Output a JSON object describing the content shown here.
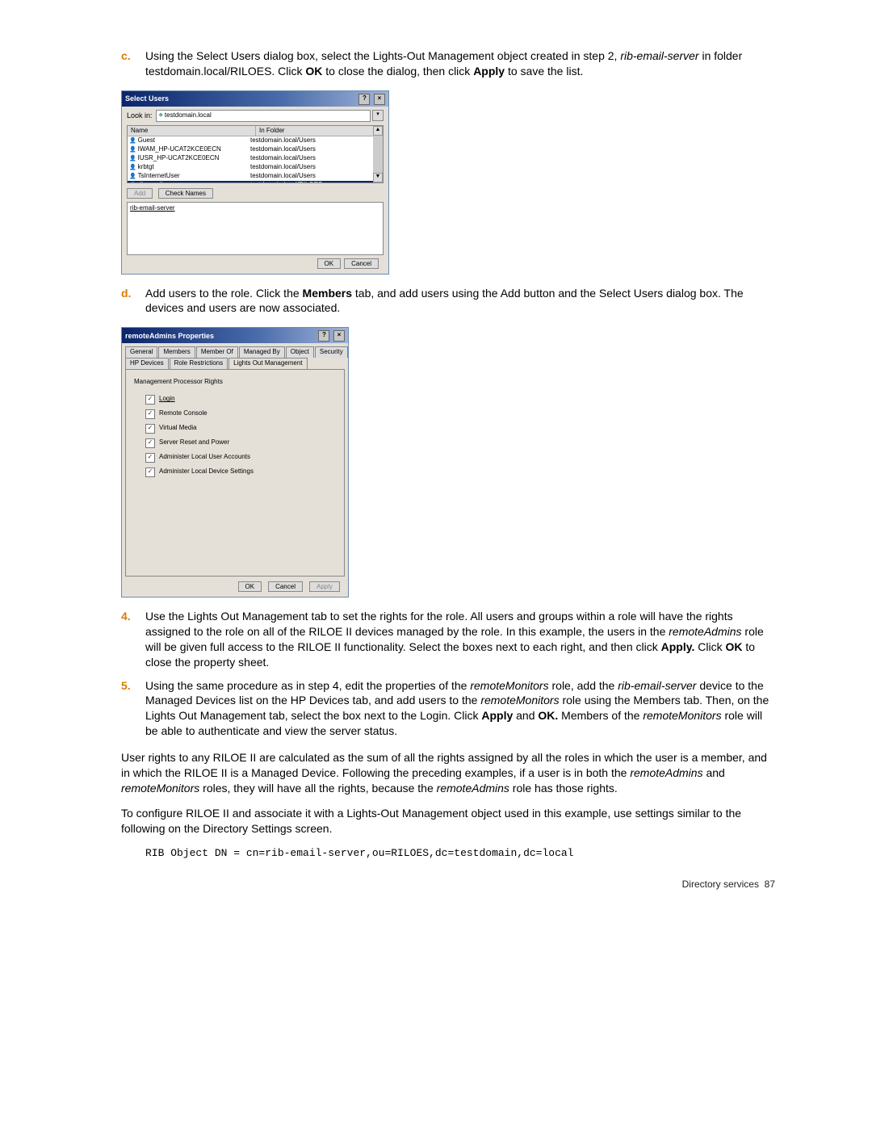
{
  "steps": {
    "c": {
      "marker": "c.",
      "pre": "Using the Select Users dialog box, select the Lights-Out Management object created in step 2, ",
      "italic": "rib-email-server",
      "mid": " in folder testdomain.local/RILOES. Click ",
      "bold1": "OK",
      "mid2": " to close the dialog, then click ",
      "bold2": "Apply",
      "post": " to save the list."
    },
    "d": {
      "marker": "d.",
      "pre": "Add users to the role. Click the ",
      "bold": "Members",
      "post": " tab, and add users using the Add button and the Select Users dialog box. The devices and users are now associated."
    },
    "s4": {
      "marker": "4.",
      "pre": "Use the Lights Out Management tab to set the rights for the role. All users and groups within a role will have the rights assigned to the role on all of the RILOE II devices managed by the role. In this example, the users in the ",
      "italic": "remoteAdmins",
      "mid": " role will be given full access to the RILOE II functionality. Select the boxes next to each right, and then click ",
      "bold1": "Apply.",
      "mid2": " Click ",
      "bold2": "OK",
      "post": " to close the property sheet."
    },
    "s5": {
      "marker": "5.",
      "pre": "Using the same procedure as in step 4, edit the properties of the ",
      "i1": "remoteMonitors",
      "mid1": " role, add the ",
      "i2": "rib-email-server",
      "mid2": " device to the Managed Devices list on the HP Devices tab, and add users to the ",
      "i3": "remoteMonitors",
      "mid3": " role using the Members tab. Then, on the Lights Out Management tab, select the box next to the Login. Click ",
      "b1": "Apply",
      "mid4": " and ",
      "b2": "OK.",
      "mid5": " Members of the ",
      "i4": "remoteMonitors",
      "post": " role will be able to authenticate and view the server status."
    }
  },
  "selectUsers": {
    "title": "Select Users",
    "lookinLabel": "Look in:",
    "lookinValue": "testdomain.local",
    "colName": "Name",
    "colFolder": "In Folder",
    "rows": [
      {
        "name": "Guest",
        "folder": "testdomain.local/Users"
      },
      {
        "name": "IWAM_HP-UCAT2KCE0ECN",
        "folder": "testdomain.local/Users"
      },
      {
        "name": "IUSR_HP-UCAT2KCE0ECN",
        "folder": "testdomain.local/Users"
      },
      {
        "name": "krbtgt",
        "folder": "testdomain.local/Users"
      },
      {
        "name": "TsInternetUser",
        "folder": "testdomain.local/Users"
      },
      {
        "name": "rib-email-server",
        "folder": "testdomain.local/RILOES"
      }
    ],
    "addBtn": "Add",
    "checkNamesBtn": "Check Names",
    "selected": "rib-email-server",
    "ok": "OK",
    "cancel": "Cancel"
  },
  "props": {
    "title": "remoteAdmins Properties",
    "tabsRow1": [
      "General",
      "Members",
      "Member Of",
      "Managed By",
      "Object",
      "Security"
    ],
    "tabsRow2": [
      "HP Devices",
      "Role Restrictions",
      "Lights Out Management"
    ],
    "activeTab": "Lights Out Management",
    "groupLabel": "Management Processor Rights",
    "rights": [
      "Login",
      "Remote Console",
      "Virtual Media",
      "Server Reset and Power",
      "Administer Local User Accounts",
      "Administer Local Device Settings"
    ],
    "ok": "OK",
    "cancel": "Cancel",
    "apply": "Apply"
  },
  "para1": {
    "pre": "User rights to any RILOE II are calculated as the sum of all the rights assigned by all the roles in which the user is a member, and in which the RILOE II is a Managed Device. Following the preceding examples, if a user is in both the ",
    "i1": "remoteAdmins",
    "mid": " and ",
    "i2": "remoteMonitors",
    "mid2": " roles, they will have all the rights, because the ",
    "i3": "remoteAdmins",
    "post": " role has those rights."
  },
  "para2": "To configure RILOE II and associate it with a Lights-Out Management object used in this example, use settings similar to the following on the Directory Settings screen.",
  "code": "RIB Object DN = cn=rib-email-server,ou=RILOES,dc=testdomain,dc=local",
  "footer": {
    "label": "Directory services",
    "page": "87"
  }
}
